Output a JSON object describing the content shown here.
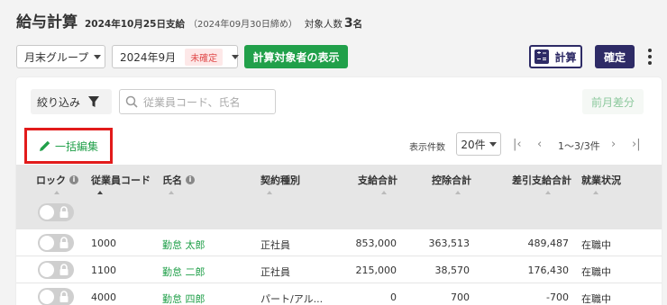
{
  "header": {
    "title": "給与計算",
    "pay_date": "2024年10月25日支給",
    "close_date": "（2024年09月30日締め）",
    "count_label": "対象人数",
    "count_value": "3",
    "count_unit": "名"
  },
  "toolbar": {
    "group_select": "月末グループ",
    "period_select": "2024年9月",
    "period_status": "未確定",
    "show_targets_button": "計算対象者の表示",
    "calc_button": "計算",
    "confirm_button": "確定"
  },
  "filters": {
    "filter_label": "絞り込み",
    "search_placeholder": "従業員コード、氏名",
    "prev_diff_button": "前月差分"
  },
  "bulk_edit": {
    "label": "一括編集"
  },
  "pagination": {
    "per_page_label": "表示件数",
    "per_page_value": "20件",
    "range": "1〜3/3件"
  },
  "table": {
    "columns": [
      "ロック",
      "従業員コード",
      "氏名",
      "契約種別",
      "支給合計",
      "控除合計",
      "差引支給合計",
      "就業状況"
    ],
    "rows": [
      {
        "code": "1000",
        "name": "勤怠 太郎",
        "contract": "正社員",
        "pay_total": "853,000",
        "deduction_total": "363,513",
        "net_total": "489,487",
        "status": "在職中"
      },
      {
        "code": "1100",
        "name": "勤怠 二郎",
        "contract": "正社員",
        "pay_total": "215,000",
        "deduction_total": "38,570",
        "net_total": "176,430",
        "status": "在職中"
      },
      {
        "code": "4000",
        "name": "勤怠 四郎",
        "contract": "パート/アル...",
        "pay_total": "0",
        "deduction_total": "700",
        "net_total": "-700",
        "status": "在職中"
      }
    ]
  },
  "colors": {
    "primary_green": "#21a04a",
    "navy": "#2e2b66",
    "highlight_red": "#e21b1b"
  }
}
